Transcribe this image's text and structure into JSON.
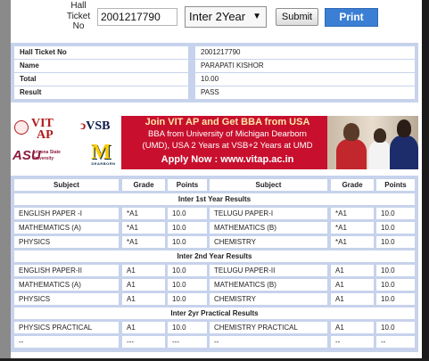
{
  "search": {
    "hall_ticket_label": "Hall Ticket No",
    "hall_ticket_value": "2001217790",
    "year_selected": "Inter 2Year",
    "submit_label": "Submit",
    "print_label": "Print"
  },
  "info": [
    {
      "label": "Hall Ticket No",
      "value": "2001217790"
    },
    {
      "label": "Name",
      "value": "PARAPATI KISHOR"
    },
    {
      "label": "Total",
      "value": "10.00"
    },
    {
      "label": "Result",
      "value": "PASS"
    }
  ],
  "banner": {
    "headline": "Join VIT AP and Get BBA from USA",
    "body_line1": "BBA from University of Michigan Dearborn",
    "body_line2": "(UMD), USA 2 Years at VSB+2 Years at UMD",
    "cta": "Apply Now : www.vitap.ac.in",
    "logo_vit": "VIT",
    "logo_ap": "AP",
    "logo_vsb": "VSB",
    "logo_asu": "ASU",
    "logo_asu_sub": "Arizona State University",
    "logo_um": "M",
    "logo_um_sub": "DEARBORN"
  },
  "marks": {
    "headers": [
      "Subject",
      "Grade",
      "Points",
      "Subject",
      "Grade",
      "Points"
    ],
    "sections": [
      {
        "title": "Inter 1st Year Results",
        "rows": [
          [
            "ENGLISH PAPER -I",
            "*A1",
            "10.0",
            "TELUGU PAPER-I",
            "*A1",
            "10.0"
          ],
          [
            "MATHEMATICS (A)",
            "*A1",
            "10.0",
            "MATHEMATICS (B)",
            "*A1",
            "10.0"
          ],
          [
            "PHYSICS",
            "*A1",
            "10.0",
            "CHEMISTRY",
            "*A1",
            "10.0"
          ]
        ]
      },
      {
        "title": "Inter 2nd Year Results",
        "rows": [
          [
            "ENGLISH PAPER-II",
            "A1",
            "10.0",
            "TELUGU PAPER-II",
            "A1",
            "10.0"
          ],
          [
            "MATHEMATICS (A)",
            "A1",
            "10.0",
            "MATHEMATICS (B)",
            "A1",
            "10.0"
          ],
          [
            "PHYSICS",
            "A1",
            "10.0",
            "CHEMISTRY",
            "A1",
            "10.0"
          ]
        ]
      },
      {
        "title": "Inter 2yr Practical Results",
        "rows": [
          [
            "PHYSICS PRACTICAL",
            "A1",
            "10.0",
            "CHEMISTRY PRACTICAL",
            "A1",
            "10.0"
          ],
          [
            "--",
            "---",
            "---",
            "--",
            "--",
            "--"
          ]
        ]
      }
    ]
  }
}
